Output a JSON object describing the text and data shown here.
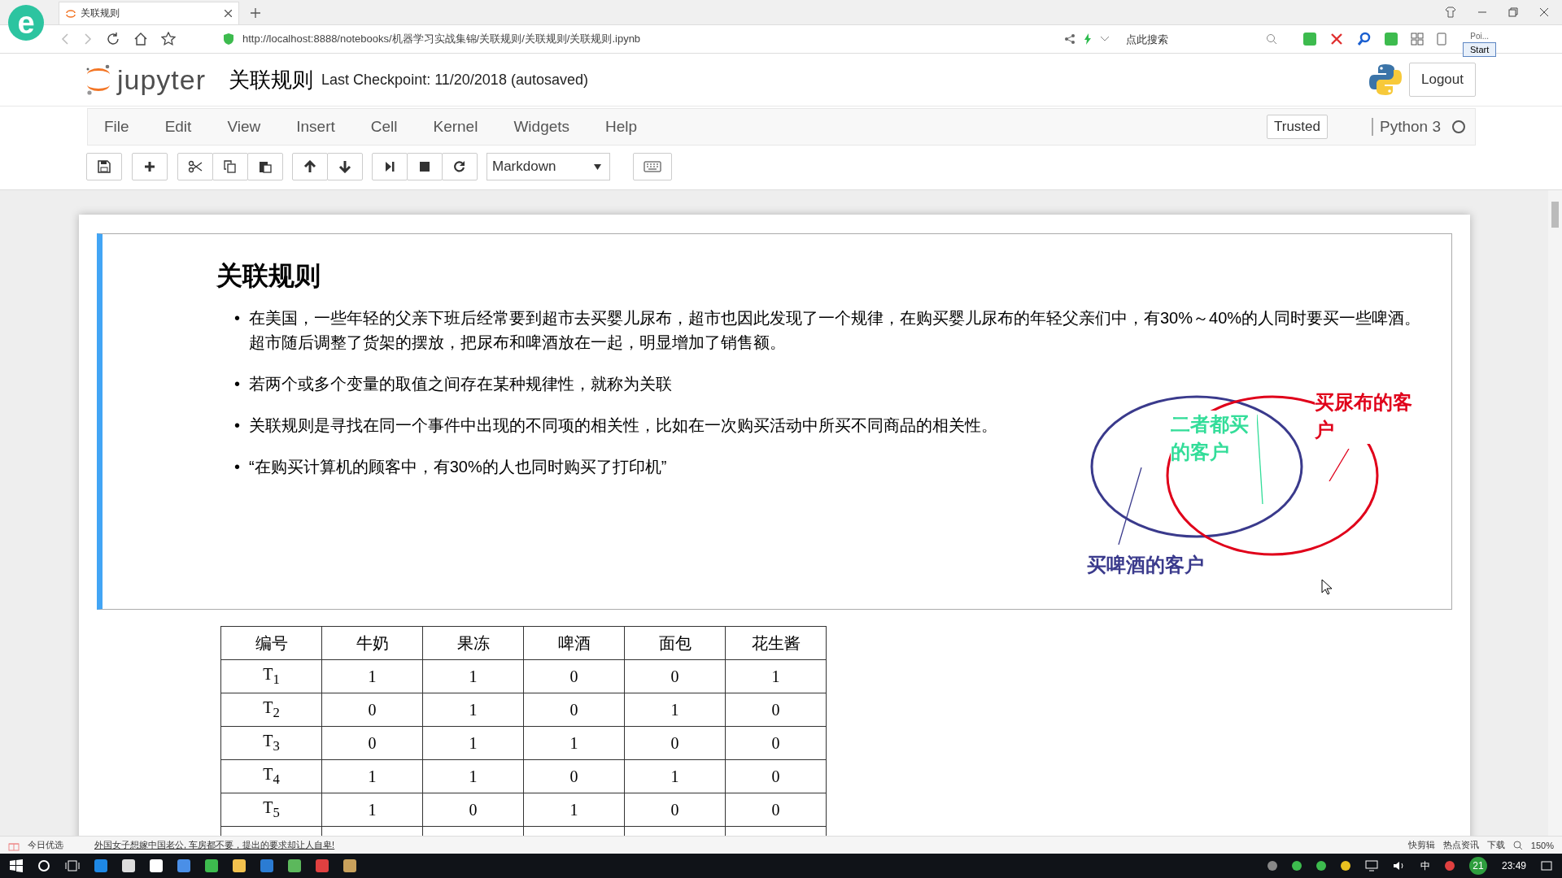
{
  "browser": {
    "logo": "e",
    "tab_title": "关联规则",
    "url": "http://localhost:8888/notebooks/机器学习实战集锦/关联规则/关联规则/关联规则.ipynb",
    "search_placeholder": "点此搜索",
    "side_text": "Poi...",
    "side_button": "Start"
  },
  "notebook": {
    "logo_text": "jupyter",
    "title": "关联规则",
    "checkpoint": "Last Checkpoint: 11/20/2018 (autosaved)",
    "logout": "Logout",
    "menu": [
      "File",
      "Edit",
      "View",
      "Insert",
      "Cell",
      "Kernel",
      "Widgets",
      "Help"
    ],
    "trusted": "Trusted",
    "kernel": "Python 3",
    "cell_type": "Markdown"
  },
  "cell": {
    "heading": "关联规则",
    "bullet": "•",
    "bullets": [
      "在美国，一些年轻的父亲下班后经常要到超市去买婴儿尿布，超市也因此发现了一个规律，在购买婴儿尿布的年轻父亲们中，有30%～40%的人同时要买一些啤酒。超市随后调整了货架的摆放，把尿布和啤酒放在一起，明显增加了销售额。",
      "若两个或多个变量的取值之间存在某种规律性，就称为关联",
      "关联规则是寻找在同一个事件中出现的不同项的相关性，比如在一次购买活动中所买不同商品的相关性。",
      "“在购买计算机的顾客中，有30%的人也同时购买了打印机”"
    ],
    "venn_labels": [
      {
        "text": "二者都买的客户",
        "color": "#33dd99"
      },
      {
        "text": "买尿布的客户",
        "color": "#e0001a"
      },
      {
        "text": "买啤酒的客户",
        "color": "#3a3a8c"
      }
    ]
  },
  "table": {
    "columns": [
      "编号",
      "牛奶",
      "果冻",
      "啤酒",
      "面包",
      "花生酱"
    ],
    "rows": [
      [
        "T$_{1}$",
        "1",
        "1",
        "0",
        "0",
        "1"
      ],
      [
        "T$_{2}$",
        "0",
        "1",
        "0",
        "1",
        "0"
      ],
      [
        "T$_{3}$",
        "0",
        "1",
        "1",
        "0",
        "0"
      ],
      [
        "T$_{4}$",
        "1",
        "1",
        "0",
        "1",
        "0"
      ],
      [
        "T$_{5}$",
        "1",
        "0",
        "1",
        "0",
        "0"
      ]
    ]
  },
  "status_bar": {
    "left": "今日优选",
    "news": "外国女子想嫁中国老公, 车房都不要，提出的要求却让人自卑!",
    "items": [
      "快剪辑",
      "热点资讯",
      "下载"
    ],
    "zoom": "150%"
  },
  "taskbar": {
    "badge": "21",
    "ime": "中",
    "clock": "23:49"
  }
}
